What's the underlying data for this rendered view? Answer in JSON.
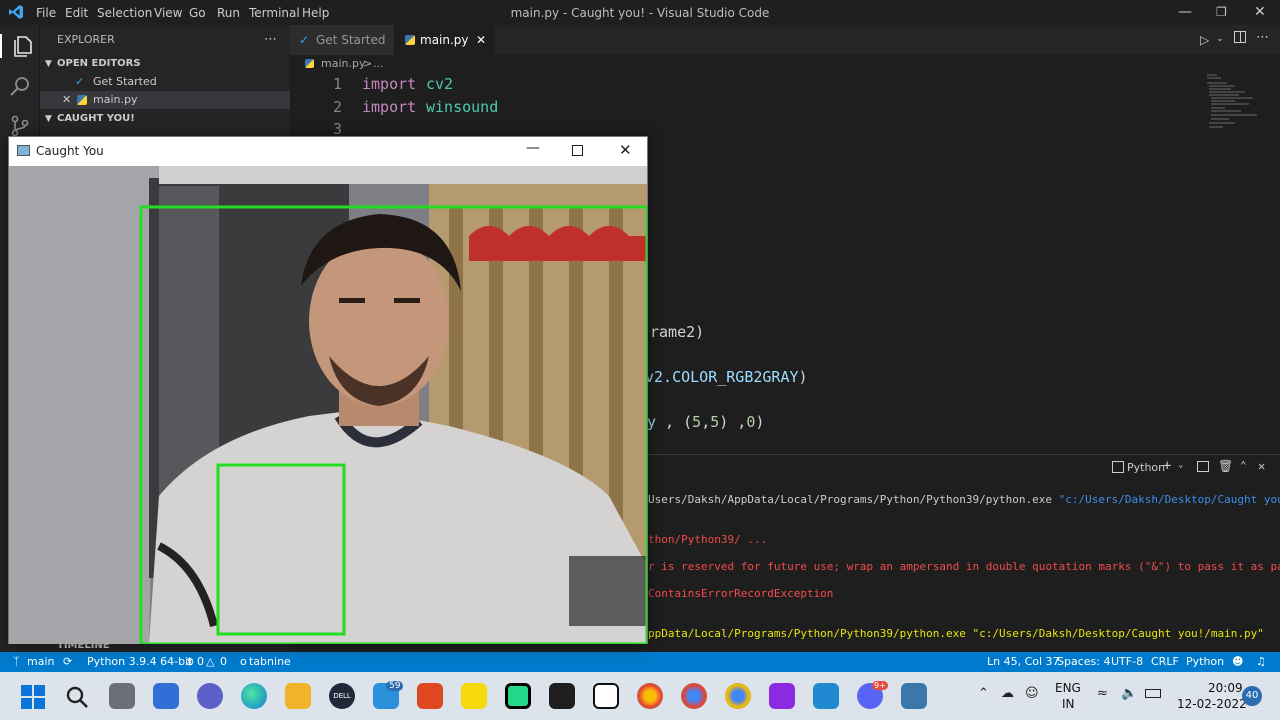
{
  "titlebar": {
    "menus": [
      "File",
      "Edit",
      "Selection",
      "View",
      "Go",
      "Run",
      "Terminal",
      "Help"
    ],
    "title": "main.py - Caught you! - Visual Studio Code"
  },
  "sidebar": {
    "explorer_title": "EXPLORER",
    "open_editors": "OPEN EDITORS",
    "files": [
      "Get Started",
      "main.py"
    ],
    "folder": "CAUGHT YOU!",
    "timeline": "TIMELINE"
  },
  "tabs": [
    {
      "label": "Get Started"
    },
    {
      "label": "main.py"
    }
  ],
  "breadcrumb": {
    "file": "main.py",
    "sep": ">",
    "rest": "..."
  },
  "editor": {
    "lines": [
      {
        "num": "1",
        "kw": "import",
        "id": "cv2"
      },
      {
        "num": "2",
        "kw": "import",
        "id": "winsound"
      },
      {
        "num": "3"
      }
    ],
    "fragments": [
      {
        "text": "rame2)"
      },
      {
        "prefix": "v2.",
        "var": "COLOR_RGB2GRAY",
        "suffix": ")"
      },
      {
        "var": "y",
        "mid": " , (",
        "n1": "5",
        "c": ",",
        "n2": "5",
        "mid2": ") ,",
        "n3": "0",
        "suffix": ")"
      }
    ]
  },
  "panel": {
    "shell": "Python",
    "lines": [
      {
        "text": "Users/Daksh/AppData/Local/Programs/Python/Python39/python.exe ",
        "path": "\"c:/Users/Daksh/Desktop/Caught you!/main",
        "color": "#cccccc"
      },
      {
        "text": "thon/Python39/ ...",
        "color": "#f14c4c"
      },
      {
        "text": "r is reserved for future use; wrap an ampersand in double quotation marks (\"&\") to pass it as part",
        "color": "#f14c4c"
      },
      {
        "text": "ContainsErrorRecordException",
        "color": "#f14c4c"
      },
      {
        "text": "ppData/Local/Programs/Python/Python39/python.exe ",
        "path": "\"c:/Users/Daksh/Desktop/Caught you!/main.py\"",
        "color": "#e5e510"
      }
    ]
  },
  "status": {
    "branch": "main",
    "python": "Python 3.9.4 64-bit",
    "errors": "0",
    "warnings": "0",
    "tabnine": "tabnine",
    "position": "Ln 45, Col 37",
    "spaces": "Spaces: 4",
    "encoding": "UTF-8",
    "eol": "CRLF",
    "language": "Python"
  },
  "taskbar": {
    "lang": "ENG",
    "region": "IN",
    "time": "20:09",
    "date": "12-02-2022",
    "notif_count": "40",
    "mail_badge": "59",
    "discord_badge": "9+"
  },
  "camera_window": {
    "title": "Caught You"
  },
  "colors": {
    "accent": "#007acc",
    "detect_box": "#22dd22"
  }
}
